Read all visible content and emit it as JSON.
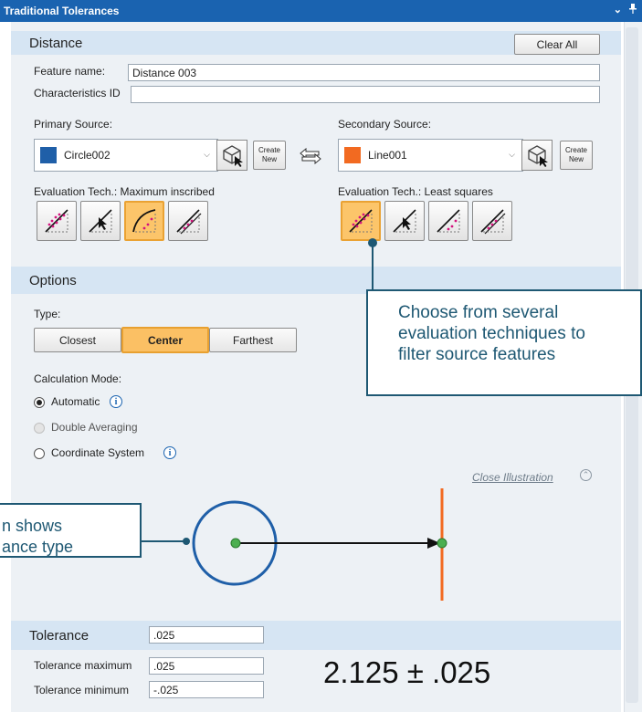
{
  "window": {
    "title": "Traditional Tolerances",
    "controls": [
      "⌄",
      "📌"
    ]
  },
  "distance": {
    "heading": "Distance",
    "clear_all": "Clear All",
    "feature_name_label": "Feature name:",
    "feature_name_value": "Distance 003",
    "characteristics_label": "Characteristics ID",
    "characteristics_value": ""
  },
  "primary": {
    "label": "Primary Source:",
    "value": "Circle002",
    "color": "#1f5fa8",
    "create_line1": "Create",
    "create_line2": "New",
    "eval_label": "Evaluation Tech.: Maximum inscribed",
    "active_index": 2
  },
  "secondary": {
    "label": "Secondary Source:",
    "value": "Line001",
    "color": "#f26a21",
    "create_line1": "Create",
    "create_line2": "New",
    "eval_label": "Evaluation Tech.: Least squares",
    "active_index": 0
  },
  "options": {
    "heading": "Options",
    "type_label": "Type:",
    "type_buttons": [
      "Closest",
      "Center",
      "Farthest"
    ],
    "type_selected": "Center",
    "calc_label": "Calculation Mode:",
    "modes": [
      {
        "label": "Automatic",
        "state": "selected",
        "info": true
      },
      {
        "label": "Double Averaging",
        "state": "disabled",
        "info": false
      },
      {
        "label": "Coordinate System",
        "state": "unselected",
        "info": true
      }
    ],
    "info_glyph": "i",
    "close_illustration": "Close Illustration",
    "collapse_glyph": "⌃"
  },
  "tolerance": {
    "heading": "Tolerance",
    "tolerance_value": ".025",
    "max_label": "Tolerance maximum",
    "max_value": ".025",
    "min_label": "Tolerance minimum",
    "min_value": "-.025",
    "display": "2.125 ± .025"
  },
  "callouts": {
    "eval_tip_line1": "Choose from several",
    "eval_tip_line2": "evaluation techniques to",
    "eval_tip_line3": "filter source features",
    "illus_tip_line1": "n shows",
    "illus_tip_line2": "ance type"
  },
  "colors": {
    "title_bar": "#1a63b0",
    "section_head": "#d6e5f3",
    "active_button": "#fbc064",
    "circle": "#1f5fa8",
    "line": "#f26a21",
    "point": "#4caf50",
    "callout_border": "#1e5873"
  }
}
